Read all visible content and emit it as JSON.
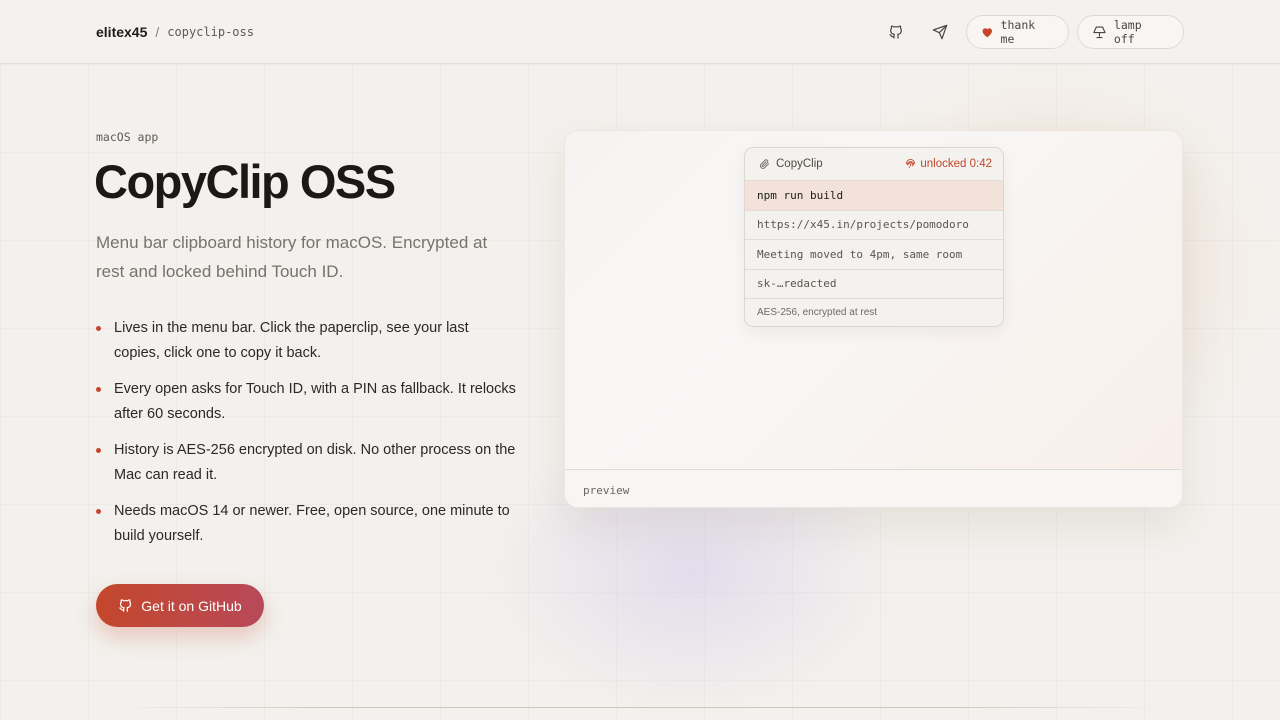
{
  "header": {
    "brand": "elitex45",
    "separator": "/",
    "repo": "copyclip-oss",
    "thank_me_label": "thank me",
    "lamp_label": "lamp off",
    "icons": [
      "github-icon",
      "send-icon",
      "heart-icon",
      "lamp-icon"
    ]
  },
  "hero": {
    "eyebrow": "macOS app",
    "title": "CopyClip OSS",
    "subtitle": "Menu bar clipboard history for macOS. Encrypted at rest and locked behind Touch ID.",
    "features": [
      "Lives in the menu bar. Click the paperclip, see your last copies, click one to copy it back.",
      "Every open asks for Touch ID, with a PIN as fallback. It relocks after 60 seconds.",
      "History is AES-256 encrypted on disk. No other process on the Mac can read it.",
      "Needs macOS 14 or newer. Free, open source, one minute to build yourself."
    ],
    "cta_label": "Get it on GitHub"
  },
  "preview": {
    "app_name": "CopyClip",
    "lock_status": "unlocked 0:42",
    "clips": [
      "npm run build",
      "https://x45.in/projects/pomodoro",
      "Meeting moved to 4pm, same room",
      "sk-…redacted"
    ],
    "footer_note": "AES-256, encrypted at rest",
    "caption": "preview"
  },
  "colors": {
    "accent": "#c4472c",
    "background": "#f3f1ed",
    "active_row": "#f2e2da"
  }
}
